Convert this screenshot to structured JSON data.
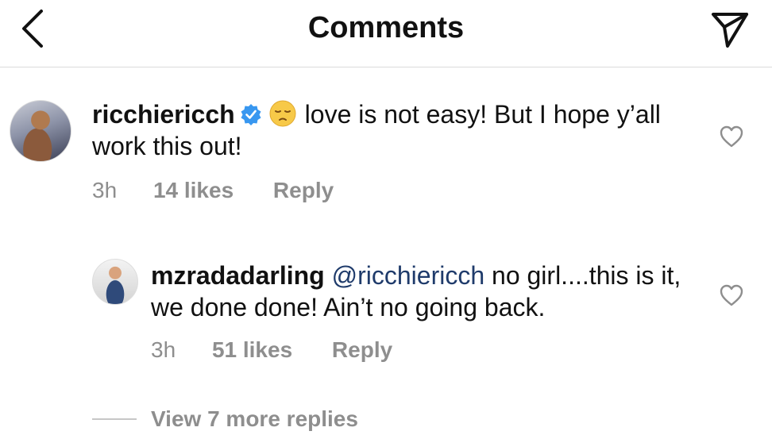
{
  "header": {
    "title": "Comments",
    "back_icon": "chevron-left-icon",
    "send_icon": "paper-plane-icon"
  },
  "comments": [
    {
      "username": "ricchiericch",
      "verified": true,
      "emoji": "😔",
      "text": "love is not easy! But I hope y’all work this out!",
      "time": "3h",
      "likes": "14 likes",
      "reply_label": "Reply"
    },
    {
      "username": "mzradadarling",
      "mention": "@ricchiericch",
      "text": "no girl....this is it, we done done! Ain’t no going back.",
      "time": "3h",
      "likes": "51 likes",
      "reply_label": "Reply"
    }
  ],
  "view_more": "View 7 more replies",
  "colors": {
    "verified_blue": "#3897f0",
    "meta_gray": "#8e8e8e",
    "mention_blue": "#1f3b6b"
  }
}
